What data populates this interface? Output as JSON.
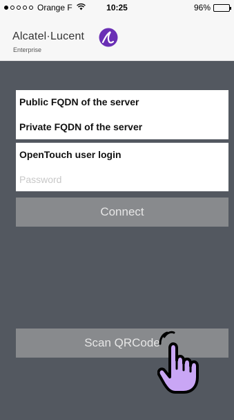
{
  "status_bar": {
    "carrier": "Orange F",
    "time": "10:25",
    "battery": "96%",
    "battery_level": 0.96,
    "signal_bars_filled": 1,
    "signal_bars_total": 5
  },
  "header": {
    "brand_name": "Alcatel·Lucent",
    "brand_sub": "Enterprise",
    "logo_color": "#6a2fb5"
  },
  "form": {
    "public_fqdn": "Public FQDN of the server",
    "private_fqdn": "Private FQDN of the server",
    "login": "OpenTouch user login",
    "password_placeholder": "Password"
  },
  "buttons": {
    "connect": "Connect",
    "scan": "Scan QRCode"
  },
  "overlay": {
    "icon": "hand-pointer-icon",
    "color": "#c9a6f5"
  }
}
